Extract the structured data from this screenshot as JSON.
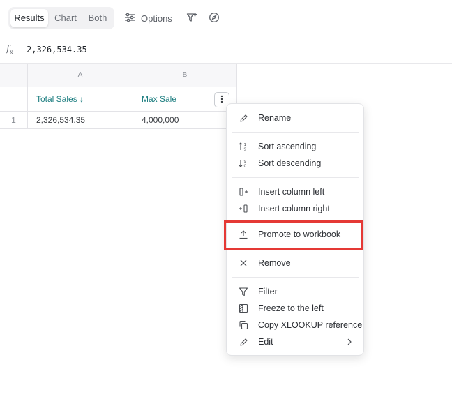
{
  "toolbar": {
    "tabs": [
      "Results",
      "Chart",
      "Both"
    ],
    "active_tab": "Results",
    "options_label": "Options"
  },
  "formula_bar": {
    "fx_label": "f",
    "fx_sub": "x",
    "value": "2,326,534.35"
  },
  "grid": {
    "column_letters": [
      "A",
      "B"
    ],
    "column_names": [
      "Total Sales ↓",
      "Max Sale"
    ],
    "rows": [
      {
        "num": "1",
        "cells": [
          "2,326,534.35",
          "4,000,000"
        ]
      }
    ]
  },
  "context_menu": {
    "items": [
      {
        "label": "Rename",
        "icon": "pencil-icon"
      },
      {
        "label": "Sort ascending",
        "icon": "sort-ascending-icon"
      },
      {
        "label": "Sort descending",
        "icon": "sort-descending-icon"
      },
      {
        "label": "Insert column left",
        "icon": "insert-column-left-icon"
      },
      {
        "label": "Insert column right",
        "icon": "insert-column-right-icon"
      },
      {
        "label": "Promote to workbook",
        "icon": "upload-icon"
      },
      {
        "label": "Remove",
        "icon": "close-icon"
      },
      {
        "label": "Filter",
        "icon": "filter-icon"
      },
      {
        "label": "Freeze to the left",
        "icon": "freeze-icon"
      },
      {
        "label": "Copy XLOOKUP reference",
        "icon": "copy-icon"
      },
      {
        "label": "Edit",
        "icon": "pencil-icon"
      }
    ],
    "highlight_color": "#e53935"
  },
  "colors": {
    "column_name": "#1d7e80",
    "header_bg": "#f7f7f9"
  }
}
